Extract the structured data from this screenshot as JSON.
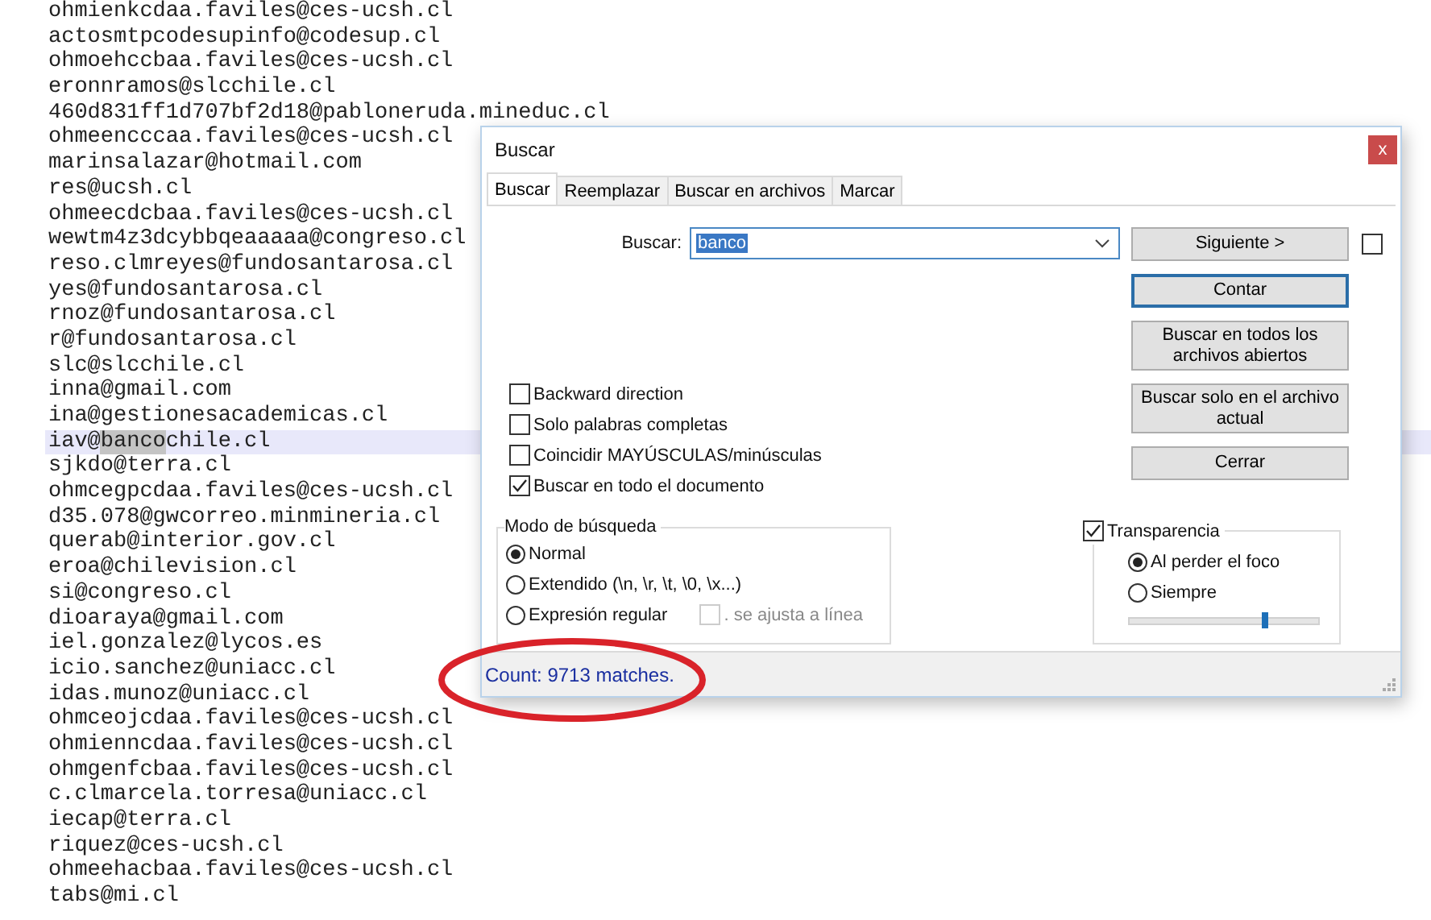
{
  "editor": {
    "lines": [
      {
        "text": "ohmienkcdaa.faviles@ces-ucsh.cl",
        "selected": false
      },
      {
        "text": "actosmtpcodesupinfo@codesup.cl",
        "selected": false
      },
      {
        "text": "ohmoehccbaa.faviles@ces-ucsh.cl",
        "selected": false
      },
      {
        "text": "eronnramos@slcchile.cl",
        "selected": false
      },
      {
        "text": "460d831ff1d707bf2d18@pabloneruda.mineduc.cl",
        "selected": false
      },
      {
        "text": "ohmeencccaa.faviles@ces-ucsh.cl",
        "selected": false
      },
      {
        "text": "marinsalazar@hotmail.com",
        "selected": false
      },
      {
        "text": "res@ucsh.cl",
        "selected": false
      },
      {
        "text": "ohmeecdcbaa.faviles@ces-ucsh.cl",
        "selected": false
      },
      {
        "text": "wewtm4z3dcybbqeaaaaa@congreso.cl",
        "selected": false
      },
      {
        "text": "reso.clmreyes@fundosantarosa.cl",
        "selected": false
      },
      {
        "text": "yes@fundosantarosa.cl",
        "selected": false
      },
      {
        "text": "rnoz@fundosantarosa.cl",
        "selected": false
      },
      {
        "text": "r@fundosantarosa.cl",
        "selected": false
      },
      {
        "text": "slc@slcchile.cl",
        "selected": false
      },
      {
        "text": "inna@gmail.com",
        "selected": false
      },
      {
        "text": "ina@gestionesacademicas.cl",
        "selected": false
      },
      {
        "text": "iav@",
        "match": "banco",
        "rest": "chile.cl",
        "selected": true
      },
      {
        "text": "sjkdo@terra.cl",
        "selected": false
      },
      {
        "text": "ohmcegpcdaa.faviles@ces-ucsh.cl",
        "selected": false
      },
      {
        "text": "d35.078@gwcorreo.minmineria.cl",
        "selected": false
      },
      {
        "text": "querab@interior.gov.cl",
        "selected": false
      },
      {
        "text": "eroa@chilevision.cl",
        "selected": false
      },
      {
        "text": "si@congreso.cl",
        "selected": false
      },
      {
        "text": "dioaraya@gmail.com",
        "selected": false
      },
      {
        "text": "iel.gonzalez@lycos.es",
        "selected": false
      },
      {
        "text": "icio.sanchez@uniacc.cl",
        "selected": false
      },
      {
        "text": "idas.munoz@uniacc.cl",
        "selected": false
      },
      {
        "text": "ohmceojcdaa.faviles@ces-ucsh.cl",
        "selected": false
      },
      {
        "text": "ohmienncdaa.faviles@ces-ucsh.cl",
        "selected": false
      },
      {
        "text": "ohmgenfcbaa.faviles@ces-ucsh.cl",
        "selected": false
      },
      {
        "text": "c.clmarcela.torresa@uniacc.cl",
        "selected": false
      },
      {
        "text": "iecap@terra.cl",
        "selected": false
      },
      {
        "text": "riquez@ces-ucsh.cl",
        "selected": false
      },
      {
        "text": "ohmeehacbaa.faviles@ces-ucsh.cl",
        "selected": false
      },
      {
        "text": "tabs@mi.cl",
        "selected": false
      }
    ]
  },
  "dialog": {
    "title": "Buscar",
    "close": "x",
    "tabs": [
      {
        "label": "Buscar",
        "selected": true
      },
      {
        "label": "Reemplazar",
        "selected": false
      },
      {
        "label": "Buscar en archivos",
        "selected": false
      },
      {
        "label": "Marcar",
        "selected": false
      }
    ],
    "find": {
      "label": "Buscar:",
      "value": "banco"
    },
    "buttons": [
      {
        "label": "Siguiente >",
        "focused": false
      },
      {
        "label": "Contar",
        "focused": true
      },
      {
        "label": "Buscar en todos los archivos abiertos",
        "focused": false
      },
      {
        "label": "Buscar solo en el archivo actual",
        "focused": false
      },
      {
        "label": "Cerrar",
        "focused": false
      }
    ],
    "side_checkbox": {
      "checked": false
    },
    "options": [
      {
        "label": "Backward direction",
        "checked": false
      },
      {
        "label": "Solo palabras completas",
        "checked": false
      },
      {
        "label": "Coincidir MAYÚSCULAS/minúsculas",
        "checked": false
      },
      {
        "label": "Buscar en todo el documento",
        "checked": true
      }
    ],
    "search_mode": {
      "title": "Modo de búsqueda",
      "modes": [
        {
          "label": "Normal",
          "selected": true
        },
        {
          "label": "Extendido (\\n, \\r, \\t, \\0, \\x...)",
          "selected": false
        },
        {
          "label": "Expresión regular",
          "selected": false
        }
      ],
      "dot_matches": {
        "label": ". se ajusta a línea",
        "checked": false,
        "disabled": true
      }
    },
    "transparency": {
      "label": "Transparencia",
      "checked": true,
      "modes": [
        {
          "label": "Al perder el foco",
          "selected": true
        },
        {
          "label": "Siempre",
          "selected": false
        }
      ],
      "level": 0.72
    },
    "status": "Count: 9713 matches."
  },
  "annotation": {
    "kind": "ellipse"
  }
}
